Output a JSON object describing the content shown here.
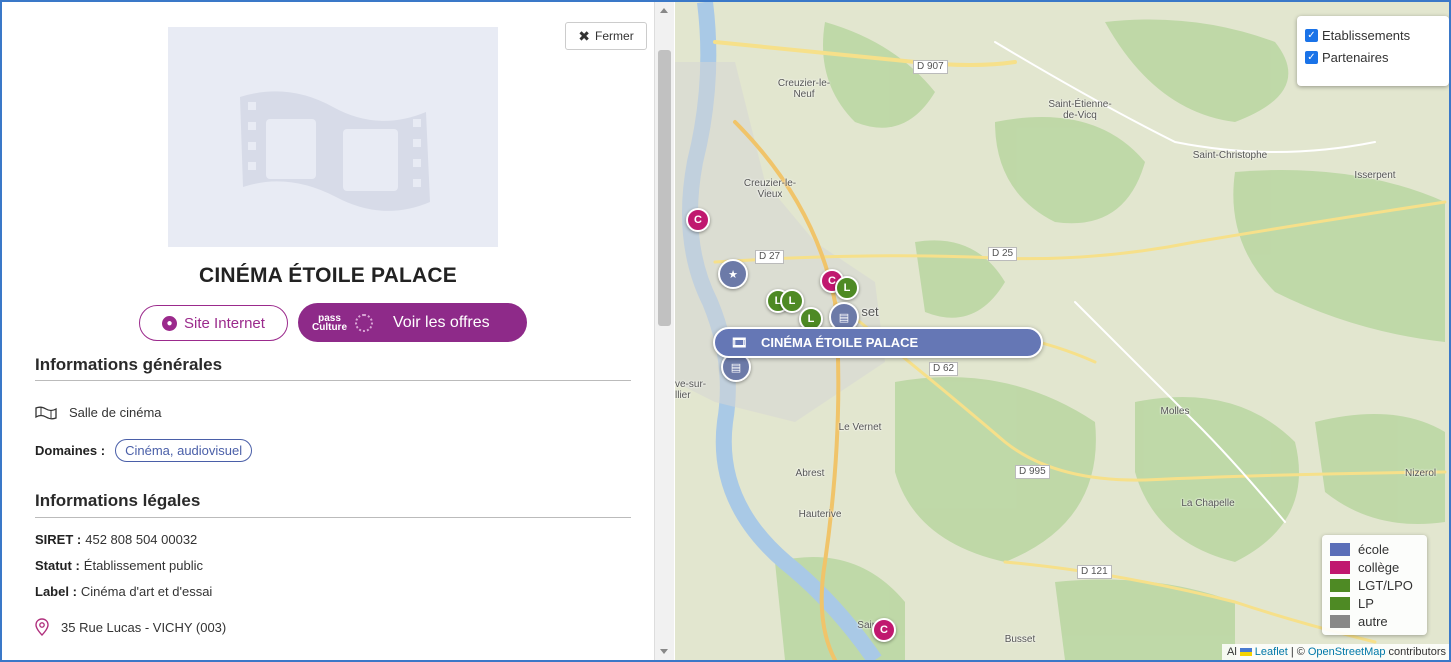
{
  "panel": {
    "close_label": "Fermer",
    "venue_name": "CINÉMA ÉTOILE PALACE",
    "website_label": "Site Internet",
    "pass_culture_logo_line1": "pass",
    "pass_culture_logo_line2": "Culture",
    "offers_label": "Voir les offres",
    "general_info_title": "Informations générales",
    "venue_type": "Salle de cinéma",
    "domains_label": "Domaines :",
    "domains": [
      "Cinéma, audiovisuel"
    ],
    "legal_info_title": "Informations légales",
    "siret_label": "SIRET :",
    "siret_value": "452 808 504 00032",
    "status_label": "Statut :",
    "status_value": "Établissement public",
    "label_label": "Label :",
    "label_value": "Cinéma d'art et d'essai",
    "address": "35 Rue Lucas - VICHY (003)"
  },
  "map": {
    "layers": {
      "items": [
        {
          "label": "Etablissements",
          "checked": true
        },
        {
          "label": "Partenaires",
          "checked": true
        }
      ]
    },
    "legend": [
      {
        "label": "école",
        "color": "#5b6fb8"
      },
      {
        "label": "collège",
        "color": "#c0186f"
      },
      {
        "label": "LGT/LPO",
        "color": "#4e8a24"
      },
      {
        "label": "LP",
        "color": "#4e8a24"
      },
      {
        "label": "autre",
        "color": "#888888"
      }
    ],
    "places": {
      "creuzier_neuf": "Creuzier-le-Neuf",
      "creuzier_vieux": "Creuzier-le-Vieux",
      "saint_etienne": "Saint-Étienne-de-Vicq",
      "saint_christophe": "Saint-Christophe",
      "isserpent": "Isserpent",
      "le_vernet": "Le Vernet",
      "abrest": "Abrest",
      "hauterive": "Hauterive",
      "molles": "Molles",
      "la_chapelle": "La Chapelle",
      "nizerolles": "Nizerol",
      "busset": "Busset",
      "saint_yorre": "Saint-Yo",
      "bellerive": "ve-sur-\nllier",
      "busset_top": "set"
    },
    "roads": {
      "d907": "D 907",
      "d27": "D 27",
      "d25": "D 25",
      "d62": "D 62",
      "d995": "D 995",
      "d121": "D 121"
    },
    "tooltip": "CINÉMA ÉTOILE PALACE",
    "marker_letters": {
      "c": "C",
      "l": "L"
    },
    "attribution": {
      "leaflet": "Leaflet",
      "separator": " | © ",
      "osm": "OpenStreetMap",
      "contributors": " contributors",
      "al": "Al"
    }
  },
  "icons": {
    "close": "close-icon",
    "globe": "globe-icon",
    "film": "film-icon",
    "pin": "map-pin-icon"
  }
}
